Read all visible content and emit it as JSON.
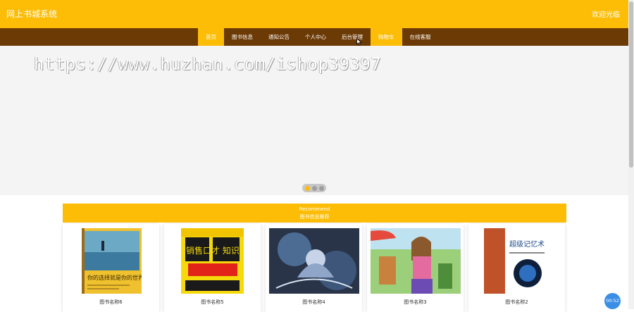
{
  "header": {
    "site_title": "网上书城系统",
    "welcome": "欢迎光临"
  },
  "nav": {
    "items": [
      {
        "label": "首页",
        "active": true
      },
      {
        "label": "图书信息"
      },
      {
        "label": "通知公告"
      },
      {
        "label": "个人中心"
      },
      {
        "label": "后台管理"
      },
      {
        "label": "购物车",
        "active": true
      },
      {
        "label": "在线客服"
      }
    ]
  },
  "banner": {
    "watermark": "https://www.huzhan.com/ishop39397",
    "carousel_dots": 3,
    "active_dot": 1
  },
  "recommend": {
    "title_en": "Recommend",
    "title_cn": "图书信息推荐"
  },
  "books": [
    {
      "name": "图书名称6",
      "cover_text": "你的选择就是你的世界"
    },
    {
      "name": "图书名称5",
      "cover_text": "销售口才 知识全集"
    },
    {
      "name": "图书名称4",
      "cover_text": ""
    },
    {
      "name": "图书名称3",
      "cover_text": ""
    },
    {
      "name": "图书名称2",
      "cover_text": "超级记忆术"
    }
  ],
  "timer": "00:52",
  "colors": {
    "primary": "#FDBD06",
    "nav_bg": "#6B3A05",
    "banner_bg": "#F4F4F4",
    "arrow": "#2E8FD8",
    "timer_bg": "#3A8EE6"
  },
  "icons": {
    "prev": "chevron-left-icon",
    "next": "chevron-right-icon",
    "cursor": "mouse-cursor-icon"
  }
}
